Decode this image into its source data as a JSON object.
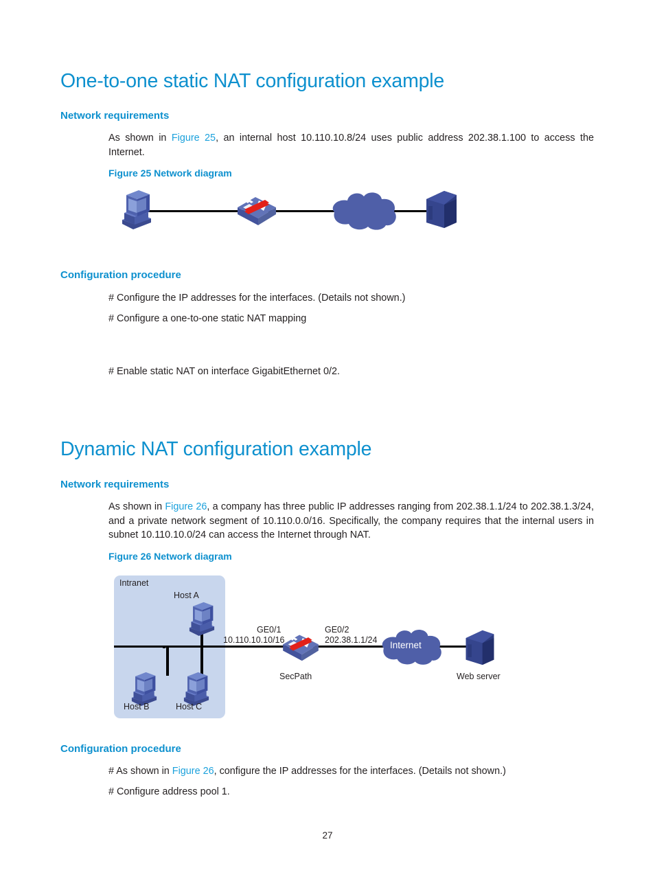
{
  "page": {
    "number": "27"
  },
  "sections": [
    {
      "title": "One-to-one static NAT configuration example",
      "subsections": {
        "requirements_heading": "Network requirements",
        "requirements_text_a": "As shown in ",
        "requirements_link": "Figure 25",
        "requirements_text_b": ", an internal host 10.110.10.8/24 uses public address 202.38.1.100 to access the Internet.",
        "figure_caption": "Figure 25 Network diagram",
        "procedure_heading": "Configuration procedure",
        "commands": [
          "# Configure the IP addresses for the interfaces. (Details not shown.)",
          "# Configure a one-to-one static NAT mapping",
          "# Enable static NAT on interface GigabitEthernet 0/2."
        ]
      }
    },
    {
      "title": "Dynamic NAT configuration example",
      "subsections": {
        "requirements_heading": "Network requirements",
        "requirements_text_a": "As shown in ",
        "requirements_link": "Figure 26",
        "requirements_text_b": ", a company has three public IP addresses ranging from 202.38.1.1/24 to 202.38.1.3/24, and a private network segment of 10.110.0.0/16. Specifically, the company requires that the internal users in subnet 10.110.10.0/24 can access the Internet through NAT.",
        "figure_caption": "Figure 26 Network diagram",
        "procedure_heading": "Configuration procedure",
        "command_1_a": "# As shown in ",
        "command_1_link": "Figure 26",
        "command_1_b": ", configure the IP addresses for the interfaces. (Details not shown.)",
        "command_2": "# Configure address pool 1."
      }
    }
  ],
  "figure25": {
    "nodes": {
      "host": "",
      "firewall": "",
      "cloud": "",
      "server": ""
    }
  },
  "figure26": {
    "zone_label": "Intranet",
    "host_a": "Host A",
    "host_b": "Host B",
    "host_c": "Host C",
    "if_left_name": "GE0/1",
    "if_left_addr": "10.110.10.10/16",
    "if_right_name": "GE0/2",
    "if_right_addr": "202.38.1.1/24",
    "device_label": "SecPath",
    "cloud_label": "Internet",
    "server_label": "Web server"
  },
  "colors": {
    "heading_blue": "#0d90ce",
    "link_blue": "#1ba1dc",
    "body_black": "#231f20",
    "intranet_fill": "#c8d6ed",
    "cloud_fill": "#4f5fa8",
    "device_blue": "#4a5fa5",
    "server_blue": "#2c3b7f",
    "accent_red": "#e32119"
  }
}
